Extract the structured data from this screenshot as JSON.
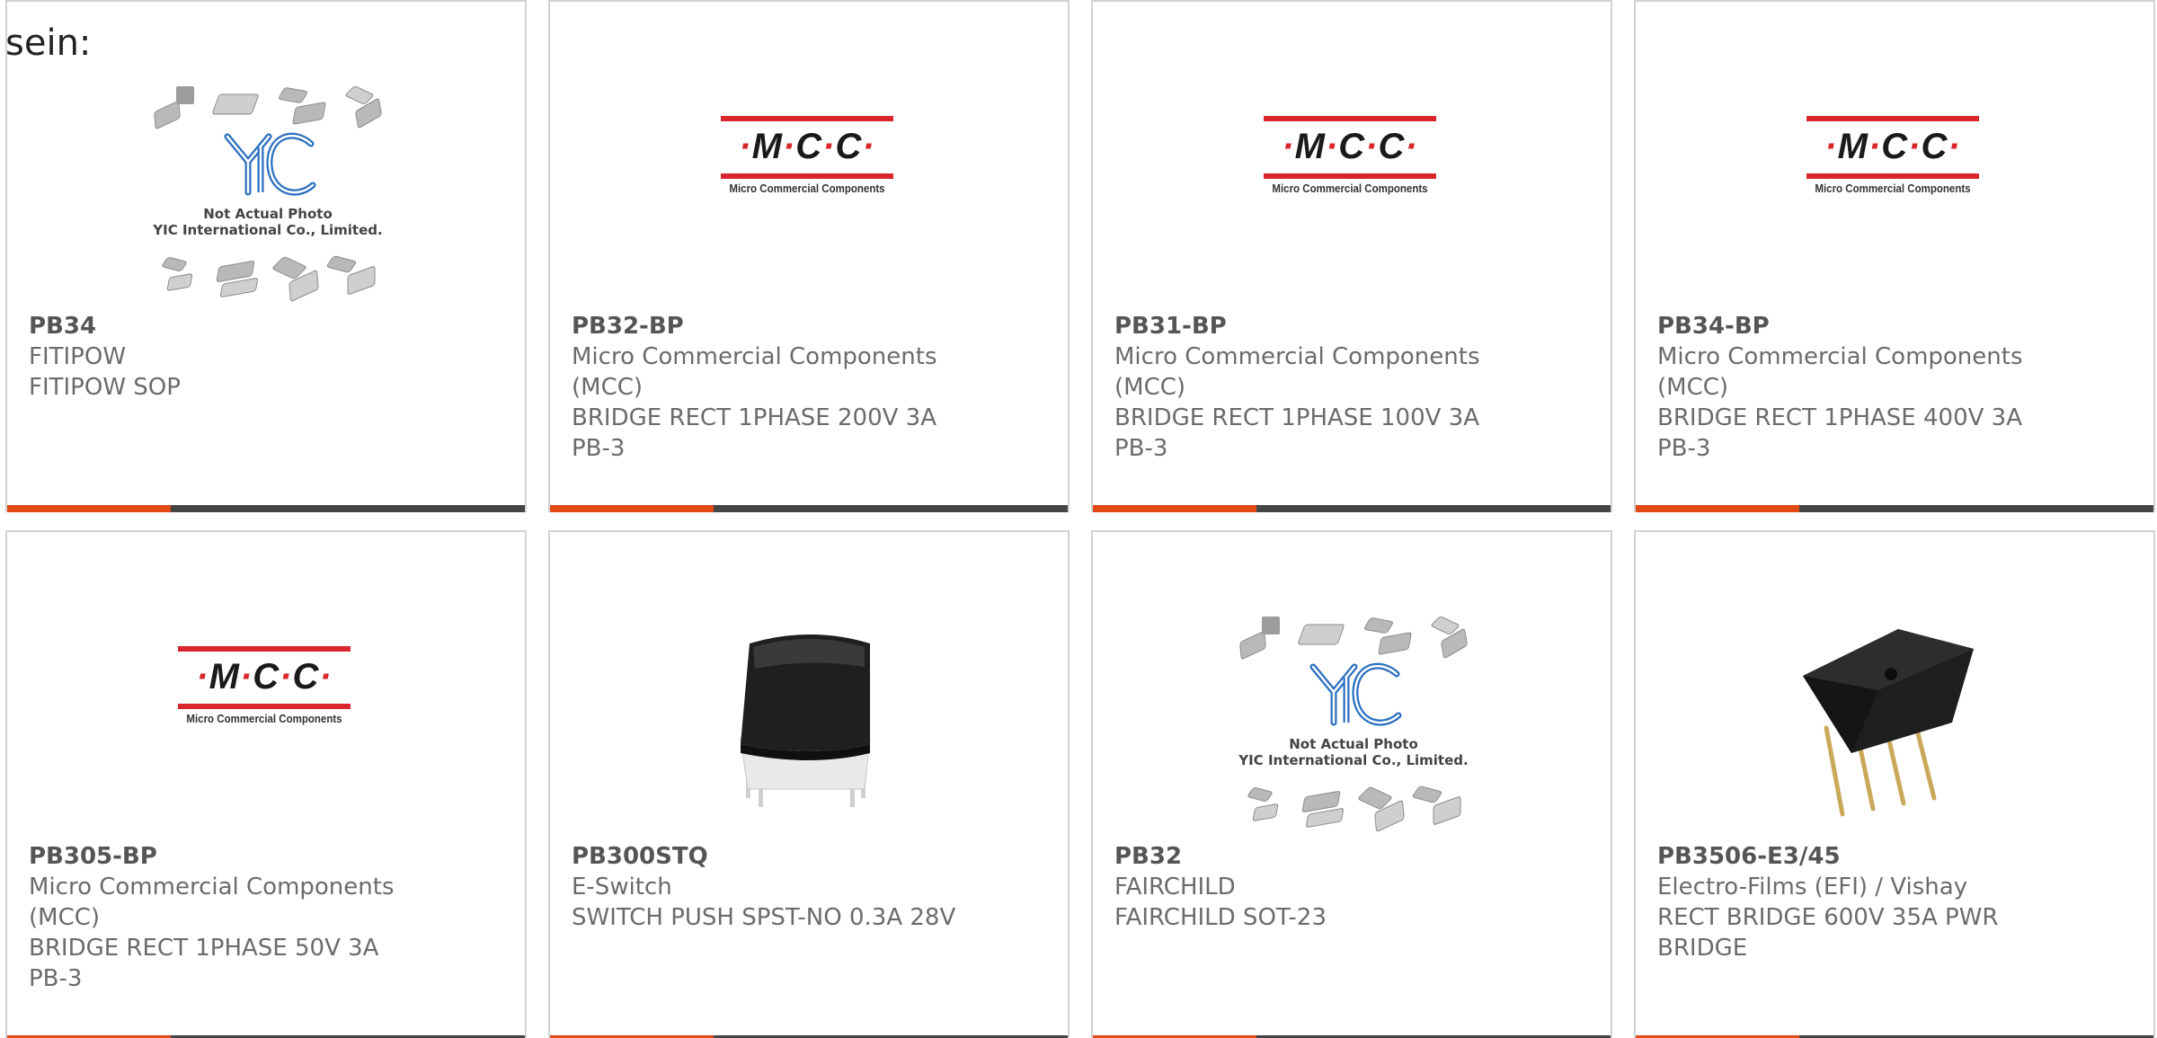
{
  "intro_text": "sein:",
  "logos": {
    "mcc_word": [
      "M",
      "C",
      "C"
    ],
    "mcc_tagline": "Micro Commercial Components",
    "yic_caption_line1": "Not Actual Photo",
    "yic_caption_line2": "YIC International Co., Limited."
  },
  "colors": {
    "accent": "#e14a16",
    "bar": "#454545",
    "border": "#d2d2d2",
    "text": "#6b6b6b"
  },
  "products": [
    {
      "part": "PB34",
      "manufacturer": [
        "FITIPOW"
      ],
      "description": [
        "FITIPOW SOP"
      ],
      "image": "yic-placeholder-icon"
    },
    {
      "part": "PB32-BP",
      "manufacturer": [
        "Micro Commercial Components",
        "(MCC)"
      ],
      "description": [
        "BRIDGE RECT 1PHASE 200V 3A",
        "PB-3"
      ],
      "image": "mcc-logo"
    },
    {
      "part": "PB31-BP",
      "manufacturer": [
        "Micro Commercial Components",
        "(MCC)"
      ],
      "description": [
        "BRIDGE RECT 1PHASE 100V 3A",
        "PB-3"
      ],
      "image": "mcc-logo"
    },
    {
      "part": "PB34-BP",
      "manufacturer": [
        "Micro Commercial Components",
        "(MCC)"
      ],
      "description": [
        "BRIDGE RECT 1PHASE 400V 3A",
        "PB-3"
      ],
      "image": "mcc-logo"
    },
    {
      "part": "PB305-BP",
      "manufacturer": [
        "Micro Commercial Components",
        "(MCC)"
      ],
      "description": [
        "BRIDGE RECT 1PHASE 50V 3A",
        "PB-3"
      ],
      "image": "mcc-logo"
    },
    {
      "part": "PB300STQ",
      "manufacturer": [
        "E-Switch"
      ],
      "description": [
        "SWITCH PUSH SPST-NO 0.3A 28V"
      ],
      "image": "push-switch-photo"
    },
    {
      "part": "PB32",
      "manufacturer": [
        "FAIRCHILD"
      ],
      "description": [
        "FAIRCHILD SOT-23"
      ],
      "image": "yic-placeholder-icon"
    },
    {
      "part": "PB3506-E3/45",
      "manufacturer": [
        "Electro-Films (EFI) / Vishay"
      ],
      "description": [
        "RECT BRIDGE 600V 35A PWR",
        "BRIDGE"
      ],
      "image": "bridge-rectifier-photo"
    }
  ]
}
